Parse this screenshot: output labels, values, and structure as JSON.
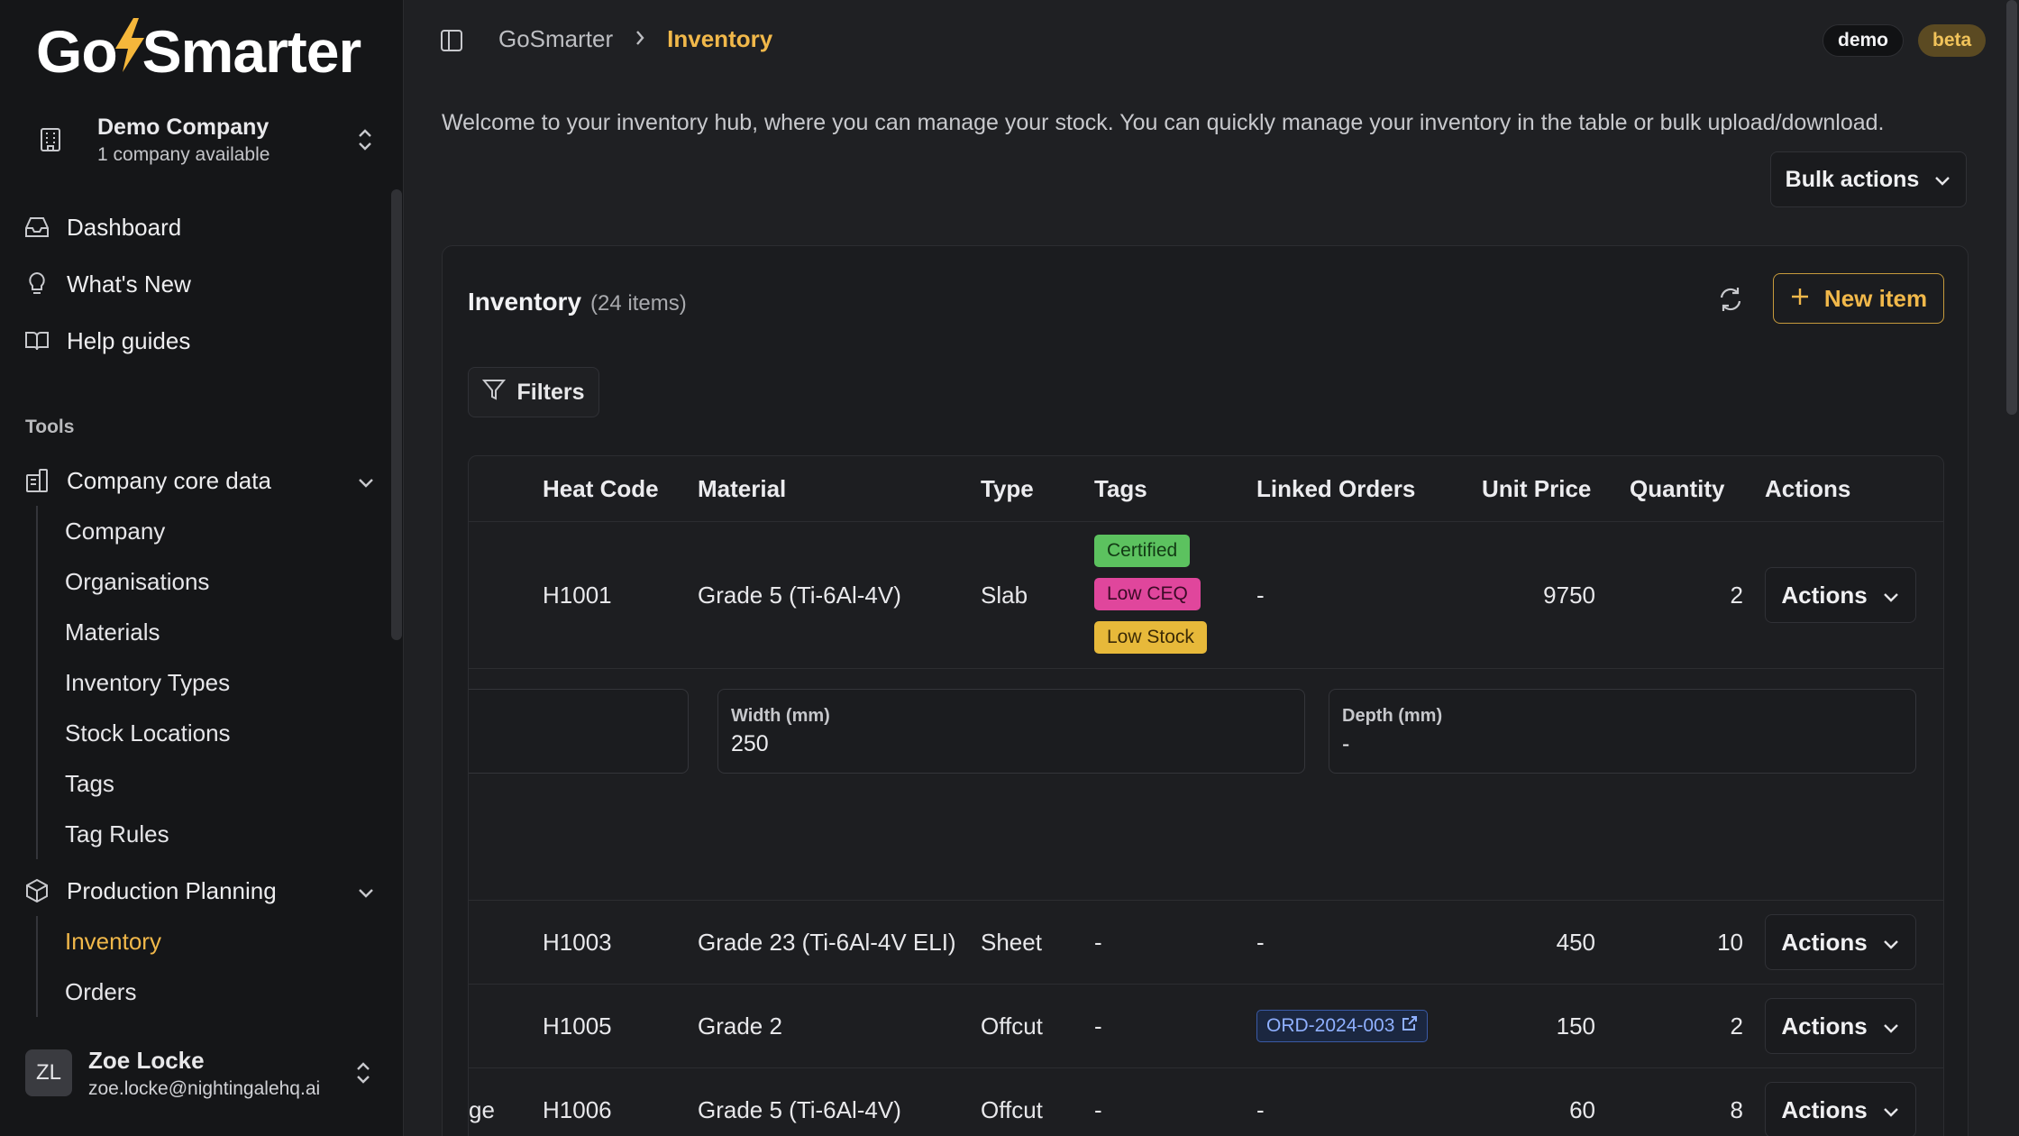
{
  "app": {
    "logo_left": "Go",
    "logo_right": "Smarter"
  },
  "company": {
    "name": "Demo Company",
    "sub": "1 company available"
  },
  "nav": {
    "dashboard": "Dashboard",
    "whats_new": "What's New",
    "help": "Help guides",
    "tools_label": "Tools",
    "core_data": "Company core data",
    "core_items": [
      "Company",
      "Organisations",
      "Materials",
      "Inventory Types",
      "Stock Locations",
      "Tags",
      "Tag Rules"
    ],
    "production": "Production Planning",
    "production_items": [
      "Inventory",
      "Orders"
    ]
  },
  "user": {
    "initials": "ZL",
    "name": "Zoe Locke",
    "email": "zoe.locke@nightingalehq.ai"
  },
  "header": {
    "breadcrumb_root": "GoSmarter",
    "breadcrumb_current": "Inventory",
    "demo_badge": "demo",
    "beta_badge": "beta"
  },
  "welcome": "Welcome to your inventory hub, where you can manage your stock. You can quickly manage your inventory in the table or bulk upload/download.",
  "bulk_actions": "Bulk actions",
  "card": {
    "title": "Inventory",
    "count": "(24 items)",
    "new_item": "New item",
    "filters": "Filters"
  },
  "table": {
    "columns": [
      "Heat Code",
      "Material",
      "Type",
      "Tags",
      "Linked Orders",
      "Unit Price",
      "Quantity",
      "Actions"
    ],
    "rows": [
      {
        "heat": "H1001",
        "material": "Grade 5 (Ti-6Al-4V)",
        "type": "Slab",
        "tags": [
          "Certified",
          "Low CEQ",
          "Low Stock"
        ],
        "orders": "-",
        "price": "9750",
        "qty": "2",
        "action": "Actions"
      },
      {
        "heat": "H1003",
        "material": "Grade 23 (Ti-6Al-4V ELI)",
        "type": "Sheet",
        "tags": "-",
        "orders": "-",
        "price": "450",
        "qty": "10",
        "action": "Actions"
      },
      {
        "heat": "H1005",
        "material": "Grade 2",
        "type": "Offcut",
        "tags": "-",
        "orders": "ORD-2024-003",
        "price": "150",
        "qty": "2",
        "action": "Actions"
      },
      {
        "clip": "ge",
        "heat": "H1006",
        "material": "Grade 5 (Ti-6Al-4V)",
        "type": "Offcut",
        "tags": "-",
        "orders": "-",
        "price": "60",
        "qty": "8",
        "action": "Actions"
      }
    ],
    "expanded": {
      "width_label": "Width (mm)",
      "width_value": "250",
      "depth_label": "Depth (mm)",
      "depth_value": "-"
    }
  }
}
